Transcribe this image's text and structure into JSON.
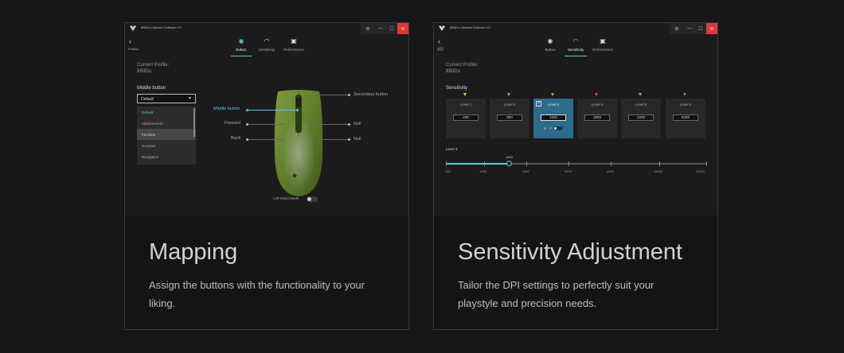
{
  "colors": {
    "accent": "#5fc4e8",
    "close": "#e0383d",
    "active_level": "#2d6b8a"
  },
  "app_name": "8BitDo Ultimate Software V2",
  "mapping_card": {
    "back_label": "Profiles",
    "tabs": [
      {
        "label": "Button",
        "icon": "mouse-icon",
        "active": true
      },
      {
        "label": "Sensitivity",
        "icon": "gauge-icon",
        "active": false
      },
      {
        "label": "Performance",
        "icon": "chip-icon",
        "active": false
      }
    ],
    "profile_label": "Current Profile:",
    "profile_name": "8BitDo",
    "middle_button_label": "Middle button",
    "dropdown_value": "Default",
    "dropdown_options": [
      "Default",
      "Alphanumeric",
      "Function",
      "Numpad",
      "Navigation"
    ],
    "mouse_labels": {
      "middle": "Middle button",
      "forward": "Forward",
      "back": "Back",
      "secondary": "Secondary button",
      "null1": "Null",
      "null2": "Null"
    },
    "left_hand_mode": "Left-Hand Mode",
    "heading": "Mapping",
    "description": "Assign the buttons with the functionality to your liking."
  },
  "sensitivity_card": {
    "back_label": "返回",
    "tabs": [
      {
        "label": "Button",
        "icon": "mouse-icon",
        "active": false
      },
      {
        "label": "Sensitivity",
        "icon": "gauge-icon",
        "active": true
      },
      {
        "label": "Performance",
        "icon": "chip-icon",
        "active": false
      }
    ],
    "profile_label": "Current Profile:",
    "profile_name": "8BitDo",
    "sensitivity_label": "Sensitivity",
    "levels": [
      {
        "name": "Level 1",
        "value": "400",
        "color": "#e8d23a",
        "active": false
      },
      {
        "name": "Level 2",
        "value": "800",
        "color": "#4fcf5a",
        "active": false
      },
      {
        "name": "Level 3",
        "value": "1600",
        "color": "#f29a2e",
        "active": true
      },
      {
        "name": "Level 4",
        "value": "1900",
        "color": "#e04aa0",
        "active": false
      },
      {
        "name": "Level 5",
        "value": "3200",
        "color": "#5fc4e8",
        "active": false
      },
      {
        "name": "Level 6",
        "value": "6400",
        "color": "#c04ae0",
        "active": false
      }
    ],
    "xy_label": "X · Y",
    "current_level": "Level 3",
    "slider": {
      "value": 1600,
      "min": 100,
      "max": 16000,
      "value_label": "1600",
      "ticks": [
        "100",
        "1000",
        "2000",
        "3000",
        "4000",
        "15000",
        "16000"
      ]
    },
    "heading": "Sensitivity Adjustment",
    "description": "Tailor the DPI settings to perfectly suit your playstyle and precision needs."
  }
}
